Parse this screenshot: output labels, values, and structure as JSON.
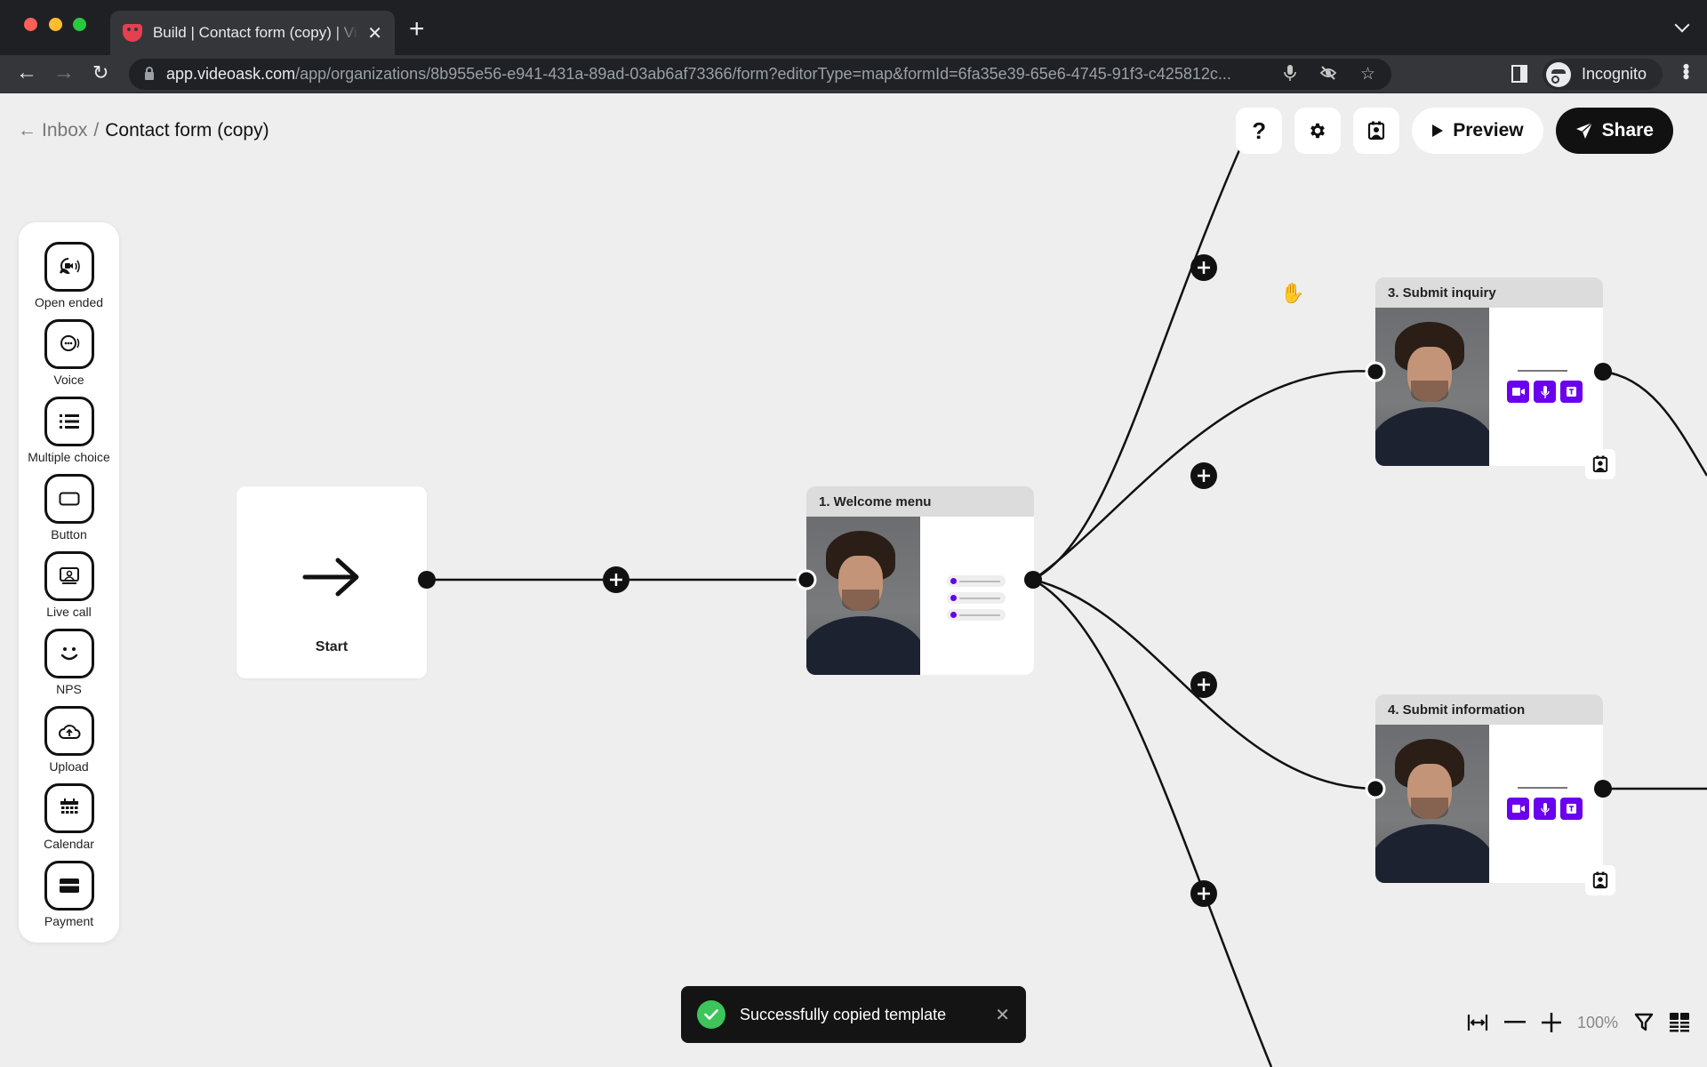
{
  "browser": {
    "tab_title": "Build | Contact form (copy) | VideoAsk",
    "new_tab_label": "+",
    "url_host": "app.videoask.com",
    "url_path": "/app/organizations/8b955e56-e941-431a-89ad-03ab6af73366/form?editorType=map&formId=6fa35e39-65e6-4745-91f3-c425812c...",
    "profile_label": "Incognito"
  },
  "header": {
    "back_link": "Inbox",
    "separator": "/",
    "title": "Contact form (copy)",
    "help_label": "?",
    "preview_label": "Preview",
    "share_label": "Share"
  },
  "palette": {
    "items": [
      {
        "label": "Open ended",
        "icon": "video-chat-icon"
      },
      {
        "label": "Voice",
        "icon": "voice-chat-icon"
      },
      {
        "label": "Multiple choice",
        "icon": "list-icon"
      },
      {
        "label": "Button",
        "icon": "button-icon"
      },
      {
        "label": "Live call",
        "icon": "live-call-icon"
      },
      {
        "label": "NPS",
        "icon": "smiley-icon"
      },
      {
        "label": "Upload",
        "icon": "cloud-upload-icon"
      },
      {
        "label": "Calendar",
        "icon": "calendar-icon"
      },
      {
        "label": "Payment",
        "icon": "credit-card-icon"
      }
    ]
  },
  "nodes": {
    "start": {
      "label": "Start"
    },
    "welcome": {
      "title": "1. Welcome menu",
      "type": "multiple-choice",
      "choices": 3
    },
    "inquiry": {
      "title": "3. Submit inquiry",
      "type": "open-ended",
      "response_types": [
        "video",
        "audio",
        "text"
      ]
    },
    "information": {
      "title": "4. Submit information",
      "type": "open-ended",
      "response_types": [
        "video",
        "audio",
        "text"
      ]
    }
  },
  "toast": {
    "message": "Successfully copied template",
    "status": "success"
  },
  "zoom": {
    "level": "100%"
  },
  "colors": {
    "accent": "#6b00ef",
    "success": "#3dc45b",
    "primary_button": "#111111",
    "canvas": "#eeeeee"
  }
}
